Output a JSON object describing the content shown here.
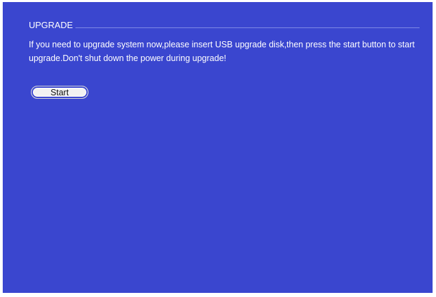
{
  "section": {
    "title": "UPGRADE"
  },
  "message": "If you need to upgrade system now,please insert USB upgrade disk,then press the start button to start upgrade.Don't shut down the power during upgrade!",
  "buttons": {
    "start_label": "Start"
  },
  "colors": {
    "background": "#3a46cf",
    "text": "#ffffff",
    "button_fill": "#f2f2f2"
  }
}
